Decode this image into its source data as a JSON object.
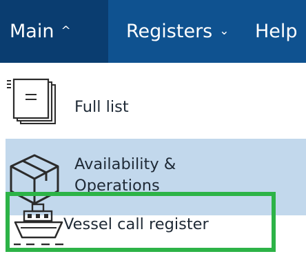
{
  "menubar": {
    "main_label": "Main",
    "main_caret": "^",
    "registers_label": "Registers",
    "registers_caret": "⌄",
    "help_label": "Help"
  },
  "dropdown": {
    "items": [
      {
        "label": "Full list",
        "icon": "document-list-icon"
      },
      {
        "label_line1": "Availability &",
        "label_line2": "Operations",
        "icon": "box-icon"
      },
      {
        "label": "Vessel call register",
        "icon": "ship-icon"
      }
    ]
  },
  "colors": {
    "menubar_bg": "#0f5290",
    "menu_active_bg": "#0a3d70",
    "selected_item_bg": "#c2d8ec",
    "highlight_border": "#2db347"
  }
}
